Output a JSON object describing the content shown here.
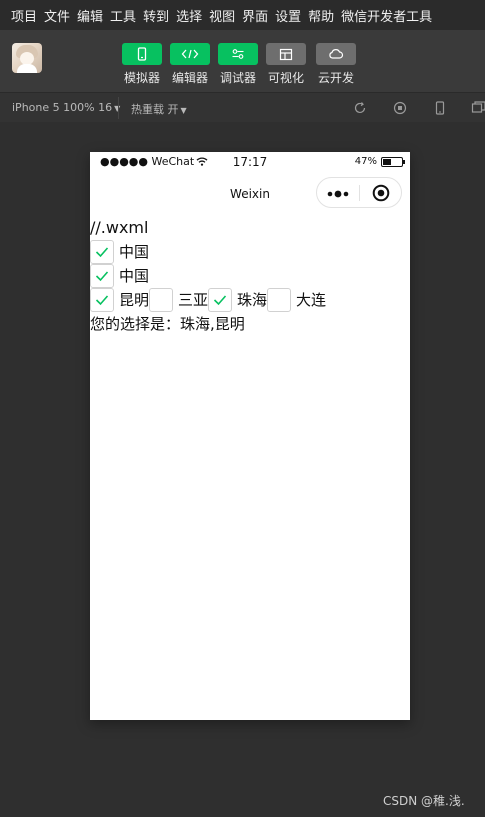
{
  "menu": [
    "项目",
    "文件",
    "编辑",
    "工具",
    "转到",
    "选择",
    "视图",
    "界面",
    "设置",
    "帮助",
    "微信开发者工具"
  ],
  "toolbar": {
    "buttons": [
      {
        "label": "模拟器",
        "icon": "phone-icon",
        "color": "#07c160"
      },
      {
        "label": "编辑器",
        "icon": "code-icon",
        "color": "#07c160"
      },
      {
        "label": "调试器",
        "icon": "debug-toggles-icon",
        "color": "#07c160"
      },
      {
        "label": "可视化",
        "icon": "layout-icon",
        "color": "#6e6e6e"
      },
      {
        "label": "云开发",
        "icon": "cloud-icon",
        "color": "#6e6e6e"
      }
    ]
  },
  "subbar": {
    "device": "iPhone 5 100% 16",
    "hotreload": "热重载 开"
  },
  "phone": {
    "carrier": "●●●●● WeChat",
    "time": "17:17",
    "battery": "47%",
    "battery_level": 0.47,
    "nav_title": "Weixin",
    "content": {
      "comment": "//.wxml",
      "row1": {
        "label": "中国",
        "checked": true
      },
      "row2": {
        "label": "中国",
        "checked": true
      },
      "cities": [
        {
          "label": "昆明",
          "checked": true
        },
        {
          "label": "三亚",
          "checked": false
        },
        {
          "label": "珠海",
          "checked": true
        },
        {
          "label": "大连",
          "checked": false
        }
      ],
      "result": "您的选择是：珠海,昆明"
    }
  },
  "watermark": "CSDN @稚.浅."
}
